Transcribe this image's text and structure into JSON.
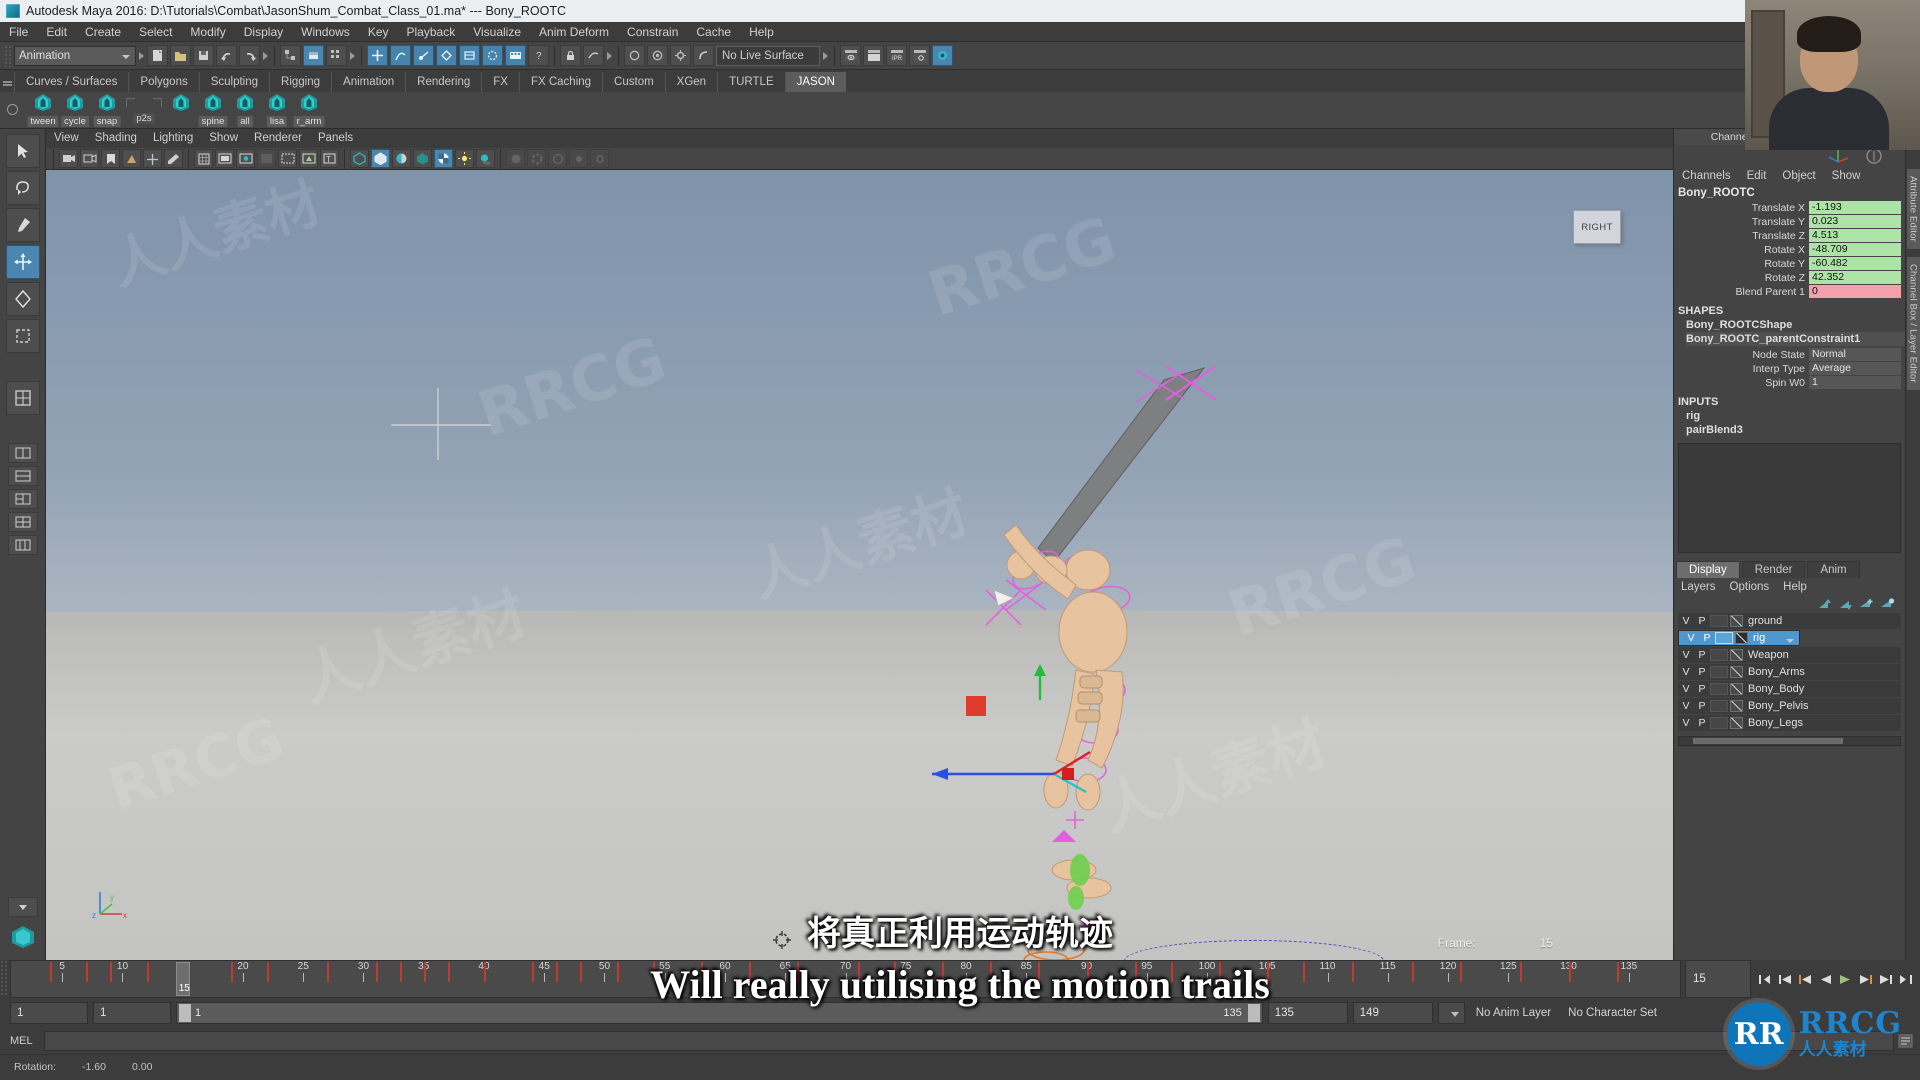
{
  "window": {
    "title": "Autodesk Maya 2016: D:\\Tutorials\\Combat\\JasonShum_Combat_Class_01.ma*  ---  Bony_ROOTC",
    "app_icon": "maya-icon"
  },
  "menubar": {
    "items": [
      "File",
      "Edit",
      "Create",
      "Select",
      "Modify",
      "Display",
      "Windows",
      "Key",
      "Playback",
      "Visualize",
      "Anim Deform",
      "Constrain",
      "Cache",
      "Help"
    ]
  },
  "statusbar": {
    "menuset": "Animation",
    "live_surface": "No Live Surface"
  },
  "shelf": {
    "tabs": [
      "Curves / Surfaces",
      "Polygons",
      "Sculpting",
      "Rigging",
      "Animation",
      "Rendering",
      "FX",
      "FX Caching",
      "Custom",
      "XGen",
      "TURTLE",
      "JASON"
    ],
    "active_tab": "JASON",
    "buttons": [
      {
        "label": "tween",
        "icon": "maya-gem-icon"
      },
      {
        "label": "cycle",
        "icon": "maya-gem-icon"
      },
      {
        "label": "snap",
        "icon": "maya-gem-icon"
      },
      {
        "label": "p2s",
        "icon": "none"
      },
      {
        "label": "",
        "icon": "maya-gem-icon"
      },
      {
        "label": "spine",
        "icon": "maya-gem-icon"
      },
      {
        "label": "all",
        "icon": "maya-gem-icon"
      },
      {
        "label": "lisa",
        "icon": "maya-gem-icon"
      },
      {
        "label": "r_arm",
        "icon": "maya-gem-icon"
      }
    ]
  },
  "viewport": {
    "menu": [
      "View",
      "Shading",
      "Lighting",
      "Show",
      "Renderer",
      "Panels"
    ],
    "view_cube_label": "RIGHT",
    "frame_label": "Frame:",
    "frame_value": "15",
    "axis_labels": [
      "z",
      "x",
      "y"
    ]
  },
  "channel_box": {
    "panel_title": "Channel Box / Layer Editor",
    "menu": [
      "Channels",
      "Edit",
      "Object",
      "Show"
    ],
    "node_name": "Bony_ROOTC",
    "attributes": [
      {
        "name": "Translate X",
        "value": "-1.193",
        "color": "green"
      },
      {
        "name": "Translate Y",
        "value": "0.023",
        "color": "green"
      },
      {
        "name": "Translate Z",
        "value": "4.513",
        "color": "green"
      },
      {
        "name": "Rotate X",
        "value": "-48.709",
        "color": "green"
      },
      {
        "name": "Rotate Y",
        "value": "-60.482",
        "color": "green"
      },
      {
        "name": "Rotate Z",
        "value": "42.352",
        "color": "green"
      },
      {
        "name": "Blend Parent 1",
        "value": "0",
        "color": "pink"
      }
    ],
    "shapes_header": "SHAPES",
    "shapes": [
      "Bony_ROOTCShape",
      "Bony_ROOTC_parentConstraint1"
    ],
    "shape_attributes": [
      {
        "name": "Node State",
        "value": "Normal",
        "color": "gray"
      },
      {
        "name": "Interp Type",
        "value": "Average",
        "color": "gray"
      },
      {
        "name": "Spin W0",
        "value": "1",
        "color": "gray"
      }
    ],
    "inputs_header": "INPUTS",
    "inputs": [
      "rig",
      "pairBlend3"
    ]
  },
  "layer_editor": {
    "tabs": [
      "Display",
      "Render",
      "Anim"
    ],
    "active_tab": "Display",
    "menu": [
      "Layers",
      "Options",
      "Help"
    ],
    "col_v": "V",
    "col_p": "P",
    "layers": [
      {
        "name": "ground",
        "selected": false
      },
      {
        "name": "rig",
        "selected": true
      },
      {
        "name": "Weapon",
        "selected": false
      },
      {
        "name": "Bony_Arms",
        "selected": false
      },
      {
        "name": "Bony_Body",
        "selected": false
      },
      {
        "name": "Bony_Pelvis",
        "selected": false
      },
      {
        "name": "Bony_Legs",
        "selected": false
      }
    ]
  },
  "vertical_tabs": [
    "Attribute Editor",
    "Channel Box / Layer Editor"
  ],
  "timeline": {
    "tick_labels": [
      "5",
      "10",
      "15",
      "20",
      "25",
      "30",
      "35",
      "40",
      "45",
      "50",
      "55",
      "60",
      "65",
      "70",
      "75",
      "80",
      "85",
      "90",
      "95",
      "100",
      "105",
      "110",
      "115",
      "120",
      "125",
      "130",
      "135"
    ],
    "current_frame": "15",
    "current_frame_field": "15",
    "keys": [
      4,
      7,
      9,
      12,
      15,
      19,
      22,
      27,
      31,
      33,
      35,
      37,
      40,
      44,
      46,
      48,
      51,
      54,
      58,
      62,
      66,
      71,
      74,
      78,
      82,
      86,
      90,
      94,
      97,
      101,
      105,
      108,
      112,
      117,
      121,
      126,
      130,
      134
    ],
    "playback_buttons": [
      "go-to-start",
      "step-back-key",
      "step-back-frame",
      "play-backwards",
      "play-forwards",
      "step-forward-frame",
      "step-forward-key",
      "go-to-end"
    ]
  },
  "range": {
    "start_field": "1",
    "end_field": "1",
    "slider_left": "1",
    "slider_right": "135",
    "range_start": "135",
    "range_end": "149",
    "anim_layer": "No Anim Layer",
    "character_set": "No Character Set"
  },
  "command_line": {
    "language": "MEL",
    "input_value": ""
  },
  "status_line": {
    "label": "Rotation:",
    "value1": "-1.60",
    "value2": "0.00"
  },
  "subtitles": {
    "chinese": "将真正利用运动轨迹",
    "english": "Will really utilising the motion trails"
  },
  "branding": {
    "logo_letters": "RR",
    "name_latin": "RRCG",
    "name_cn": "人人素材",
    "watermarks": [
      "RRCG",
      "人人素材"
    ]
  },
  "colors": {
    "accent_blue": "#4a86b0",
    "selection_blue": "#4f97cf",
    "keyframe_red": "#c03a32",
    "attr_green": "#aee3a8",
    "attr_pink": "#f3a2ad",
    "brand_blue": "#1d85cf"
  }
}
